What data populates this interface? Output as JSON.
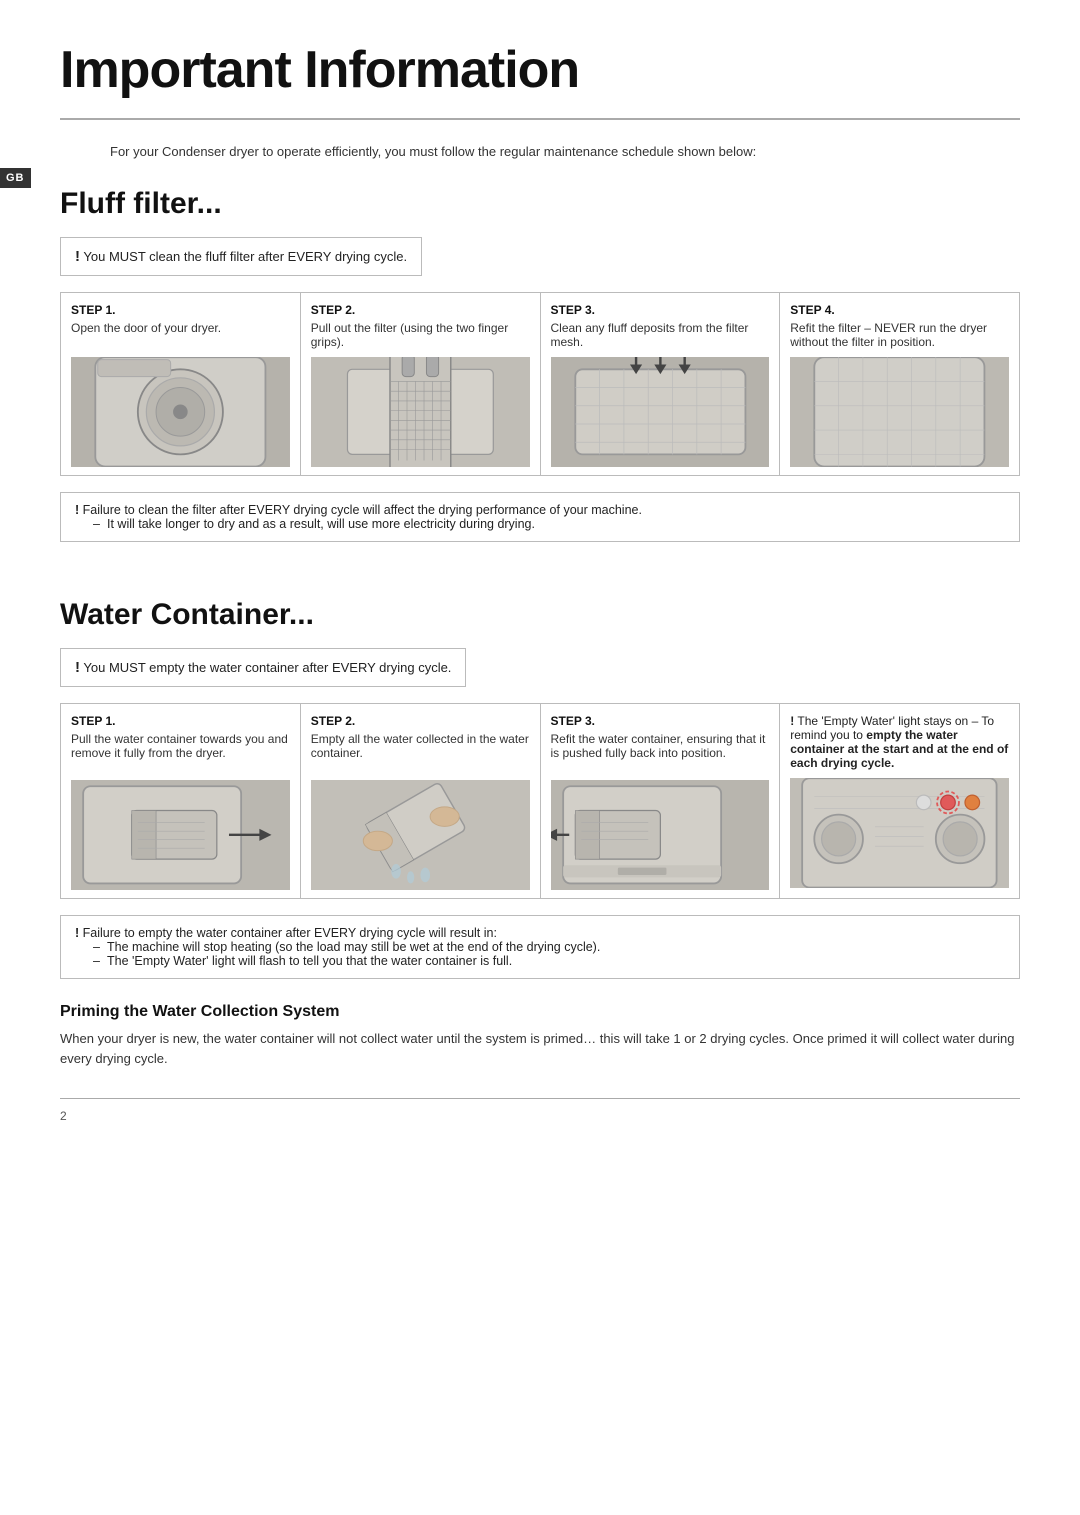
{
  "page": {
    "title": "Important Information",
    "gb_label": "GB",
    "intro": "For your Condenser dryer to operate efficiently, you must follow the regular maintenance schedule shown below:",
    "page_number": "2"
  },
  "fluff_filter": {
    "section_title": "Fluff filter...",
    "notice": {
      "exclaim": "!",
      "text": "You MUST clean the fluff filter after EVERY drying cycle."
    },
    "steps": [
      {
        "label": "STEP 1.",
        "text": "Open the door of your dryer.",
        "img_class": "img-step1"
      },
      {
        "label": "STEP 2.",
        "text": "Pull out the filter (using the two finger grips).",
        "img_class": "img-step2"
      },
      {
        "label": "STEP 3.",
        "text": "Clean any fluff deposits from the filter mesh.",
        "img_class": "img-step3"
      },
      {
        "label": "STEP 4.",
        "text": "Refit the filter – NEVER run the dryer without the filter in position.",
        "img_class": "img-step4"
      }
    ],
    "warning": {
      "exclaim": "!",
      "main": "Failure to clean the filter after EVERY drying cycle will affect the drying performance of your machine.",
      "items": [
        "It will take longer to dry and as a result, will use more electricity during drying."
      ]
    }
  },
  "water_container": {
    "section_title": "Water Container...",
    "notice": {
      "exclaim": "!",
      "text": "You MUST empty the water container after EVERY drying cycle."
    },
    "steps": [
      {
        "label": "STEP 1.",
        "text": "Pull the water container towards you and remove it fully from the dryer.",
        "img_class": "img-wstep1"
      },
      {
        "label": "STEP 2.",
        "text": "Empty all the water collected in the water container.",
        "img_class": "img-wstep2"
      },
      {
        "label": "STEP 3.",
        "text": "Refit the water container, ensuring that it is pushed fully back into position.",
        "img_class": "img-wstep3"
      }
    ],
    "step4_notice": {
      "exclaim": "!",
      "text_plain": " The 'Empty Water' light stays on – To remind you to ",
      "text_bold": "empty the water container at the start and at the end of each drying cycle.",
      "img_class": "img-wstep4"
    },
    "warning": {
      "exclaim": "!",
      "main": "Failure to empty the water container after EVERY drying cycle will result in:",
      "items": [
        "The machine will stop heating (so the load may still be wet at the end of the drying cycle).",
        "The 'Empty Water' light will flash to tell you that the water container is full."
      ]
    },
    "priming": {
      "subtitle": "Priming the Water Collection System",
      "text": "When your dryer is new, the water container will not collect water until the system is primed… this will take 1 or 2 drying cycles. Once primed it will collect water during every drying cycle."
    }
  }
}
